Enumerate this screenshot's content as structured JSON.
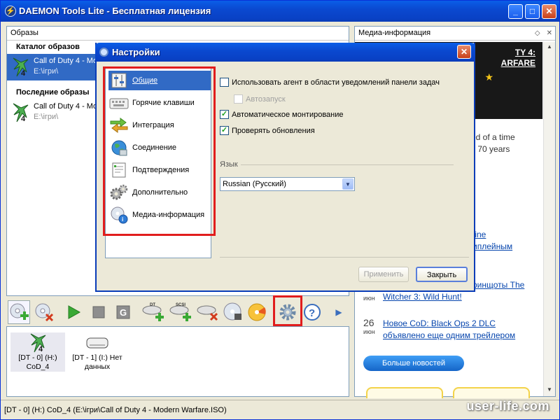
{
  "app": {
    "title": "DAEMON Tools Lite - Бесплатная лицензия",
    "min_label": "_",
    "max_label": "□",
    "close_label": "✕"
  },
  "left_pane": {
    "header": "Образы",
    "catalog_header": "Каталог образов",
    "catalog_items": [
      {
        "name": "Call of Duty 4 - Mo",
        "path": "E:\\ігри\\"
      }
    ],
    "recent_header": "Последние образы",
    "recent_items": [
      {
        "name": "Call of Duty 4 - Mo",
        "path": "E:\\ігри\\"
      }
    ]
  },
  "right_pane": {
    "header": "Медиа-информация",
    "controls": [
      "◇",
      "✕"
    ],
    "game_title": "TY 4:\nARFARE",
    "media_text": "ed of a time\ns 70 years",
    "partial_links": [
      "tine",
      "иплейным",
      "ринщоты The"
    ],
    "news": [
      {
        "day": "",
        "month": "июн",
        "title": "Witcher 3: Wild Hunt!"
      },
      {
        "day": "26",
        "month": "июн",
        "title": "Новое CoD: Black Ops 2 DLC\nобъявлено еще одним трейлером"
      }
    ],
    "more_news": "Больше новостей"
  },
  "toolbar": {
    "buttons": [
      "add-image",
      "remove-image",
      "play",
      "stop",
      "refresh",
      "add-dt-drive",
      "add-scsi-drive",
      "remove-drive",
      "write-disc",
      "burn-disc",
      "settings",
      "help",
      "more"
    ],
    "dt_label": "DT",
    "scsi_label": "SCSI",
    "help_glyph": "?",
    "more_glyph": "▶"
  },
  "drives": [
    {
      "label": "[DT - 0] (H:)\nCoD_4"
    },
    {
      "label": "[DT - 1] (I:) Нет\nданных"
    }
  ],
  "status": {
    "text": "[DT - 0] (H:) CoD_4 (E:\\ігри\\Call of Duty 4 - Modern Warfare.ISO)"
  },
  "watermark": "user-life.com",
  "settings": {
    "title": "Настройки",
    "close_label": "✕",
    "categories": [
      {
        "label": "Общие",
        "icon": "general-icon"
      },
      {
        "label": "Горячие клавиши",
        "icon": "keyboard-icon"
      },
      {
        "label": "Интеграция",
        "icon": "integration-icon"
      },
      {
        "label": "Соединение",
        "icon": "globe-icon"
      },
      {
        "label": "Подтверждения",
        "icon": "confirm-icon"
      },
      {
        "label": "Дополнительно",
        "icon": "gears-icon"
      },
      {
        "label": "Медиа-информация",
        "icon": "media-info-icon"
      }
    ],
    "selected_category": 0,
    "options": {
      "tray_agent": {
        "label": "Использовать агент в области уведомлений панели задач",
        "checked": false
      },
      "autostart": {
        "label": "Автозапуск",
        "checked": false,
        "disabled": true
      },
      "automount": {
        "label": "Автоматическое монтирование",
        "checked": true
      },
      "check_updates": {
        "label": "Проверять обновления",
        "checked": true
      }
    },
    "language": {
      "label": "Язык",
      "selected": "Russian (Русский)"
    },
    "apply_label": "Применить",
    "close_button_label": "Закрыть"
  },
  "colors": {
    "title_blue": "#0a49d0",
    "selection_blue": "#316ac5",
    "highlight_red": "#e11d1d",
    "link_blue": "#0645ad"
  }
}
